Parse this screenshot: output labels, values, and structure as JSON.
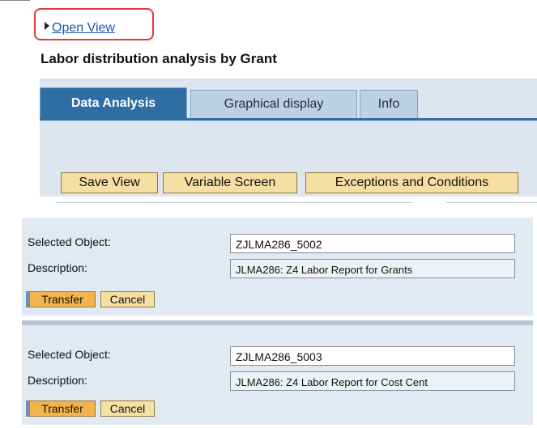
{
  "header": {
    "open_view_label": "Open View",
    "page_title": "Labor distribution analysis by Grant"
  },
  "tabs": [
    {
      "label": "Data Analysis",
      "active": true
    },
    {
      "label": "Graphical display",
      "active": false
    },
    {
      "label": "Info",
      "active": false
    }
  ],
  "toolbar": {
    "save_view": "Save View",
    "variable_screen": "Variable Screen",
    "exceptions": "Exceptions and Conditions"
  },
  "dialogs": [
    {
      "selected_object_label": "Selected Object:",
      "selected_object_value": "ZJLMA286_5002",
      "description_label": "Description:",
      "description_value": "JLMA286: Z4 Labor Report for Grants",
      "transfer_label": "Transfer",
      "cancel_label": "Cancel"
    },
    {
      "selected_object_label": "Selected Object:",
      "selected_object_value": "ZJLMA286_5003",
      "description_label": "Description:",
      "description_value": "JLMA286: Z4 Labor Report for Cost Cent",
      "transfer_label": "Transfer",
      "cancel_label": "Cancel"
    }
  ],
  "colors": {
    "highlight_red": "#e23b3b",
    "tab_active": "#2f6ea4",
    "button_yellow": "#f7dfa4",
    "button_orange": "#f3b54b",
    "dialog_bg": "#e1e9f2"
  }
}
